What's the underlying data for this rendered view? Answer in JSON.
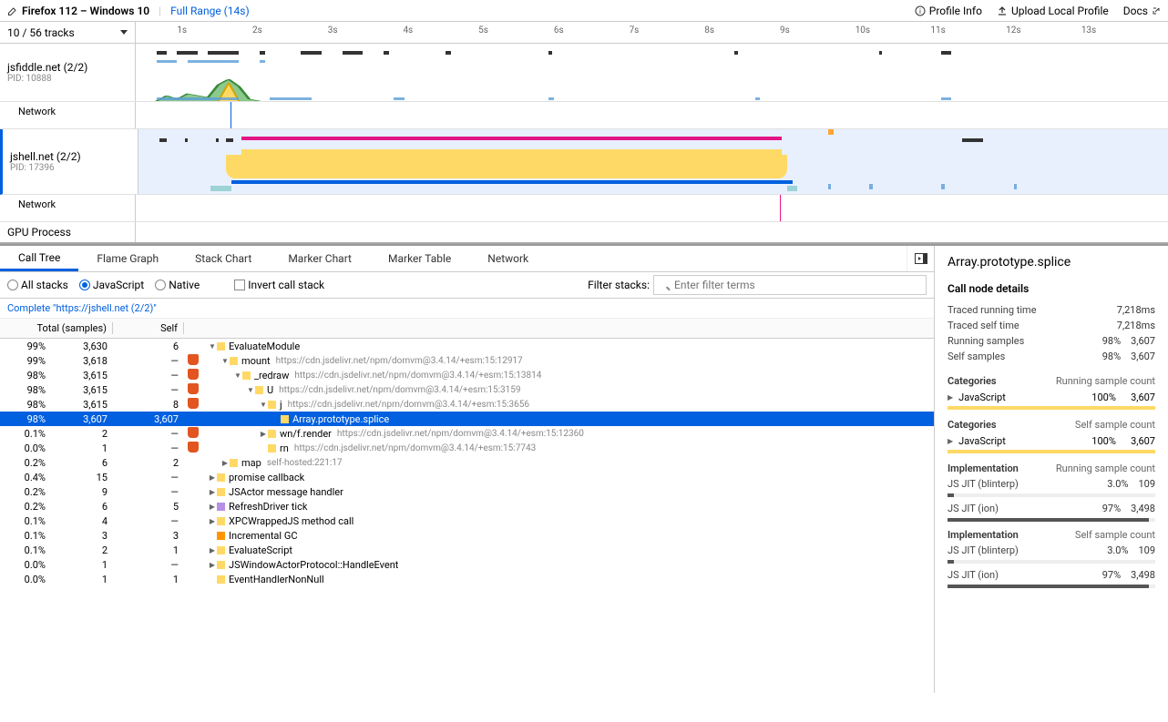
{
  "topbar": {
    "profile_name": "Firefox 112 – Windows 10",
    "range_label": "Full Range (14s)",
    "profile_info": "Profile Info",
    "upload": "Upload Local Profile",
    "docs": "Docs"
  },
  "timeline": {
    "track_count": "10 / 56 tracks",
    "ticks": [
      "1s",
      "2s",
      "3s",
      "4s",
      "5s",
      "6s",
      "7s",
      "8s",
      "9s",
      "10s",
      "11s",
      "12s",
      "13s"
    ],
    "tracks": [
      {
        "title": "jsfiddle.net (2/2)",
        "pid": "PID: 10888",
        "network": "Network"
      },
      {
        "title": "jshell.net (2/2)",
        "pid": "PID: 17396",
        "network": "Network"
      },
      {
        "title": "GPU Process"
      }
    ]
  },
  "tabs": [
    "Call Tree",
    "Flame Graph",
    "Stack Chart",
    "Marker Chart",
    "Marker Table",
    "Network"
  ],
  "toolbar": {
    "stack_radios": [
      "All stacks",
      "JavaScript",
      "Native"
    ],
    "invert": "Invert call stack",
    "filter_label": "Filter stacks:",
    "filter_placeholder": "Enter filter terms"
  },
  "breadcrumb": "Complete \"https://jshell.net (2/2)\"",
  "tree_headers": {
    "total": "Total (samples)",
    "self": "Self"
  },
  "tree": [
    {
      "tp": "99%",
      "tv": "3,630",
      "sv": "6",
      "badge": "",
      "indent": 0,
      "twisty": "▼",
      "cat": "js",
      "name": "EvaluateModule",
      "path": ""
    },
    {
      "tp": "99%",
      "tv": "3,618",
      "sv": "—",
      "badge": "s",
      "indent": 1,
      "twisty": "▼",
      "cat": "js",
      "name": "mount",
      "path": "https://cdn.jsdelivr.net/npm/domvm@3.4.14/+esm:15:12917"
    },
    {
      "tp": "98%",
      "tv": "3,615",
      "sv": "—",
      "badge": "s",
      "indent": 2,
      "twisty": "▼",
      "cat": "js",
      "name": "_redraw",
      "path": "https://cdn.jsdelivr.net/npm/domvm@3.4.14/+esm:15:13814"
    },
    {
      "tp": "98%",
      "tv": "3,615",
      "sv": "—",
      "badge": "s",
      "indent": 3,
      "twisty": "▼",
      "cat": "js",
      "name": "U",
      "path": "https://cdn.jsdelivr.net/npm/domvm@3.4.14/+esm:15:3159"
    },
    {
      "tp": "98%",
      "tv": "3,615",
      "sv": "8",
      "badge": "s",
      "indent": 4,
      "twisty": "▼",
      "cat": "js",
      "name": "j",
      "path": "https://cdn.jsdelivr.net/npm/domvm@3.4.14/+esm:15:3656"
    },
    {
      "tp": "98%",
      "tv": "3,607",
      "sv": "3,607",
      "badge": "",
      "indent": 5,
      "twisty": "",
      "cat": "js",
      "name": "Array.prototype.splice",
      "path": "",
      "selected": true
    },
    {
      "tp": "0.1%",
      "tv": "2",
      "sv": "—",
      "badge": "s",
      "indent": 4,
      "twisty": "▶",
      "cat": "js",
      "name": "wn/f.render",
      "path": "https://cdn.jsdelivr.net/npm/domvm@3.4.14/+esm:15:12360"
    },
    {
      "tp": "0.0%",
      "tv": "1",
      "sv": "—",
      "badge": "s",
      "indent": 4,
      "twisty": "",
      "cat": "js",
      "name": "rn",
      "path": "https://cdn.jsdelivr.net/npm/domvm@3.4.14/+esm:15:7743"
    },
    {
      "tp": "0.2%",
      "tv": "6",
      "sv": "2",
      "badge": "",
      "indent": 1,
      "twisty": "▶",
      "cat": "js",
      "name": "map",
      "path": "self-hosted:221:17"
    },
    {
      "tp": "0.4%",
      "tv": "15",
      "sv": "—",
      "badge": "",
      "indent": 0,
      "twisty": "▶",
      "cat": "js",
      "name": "promise callback",
      "path": ""
    },
    {
      "tp": "0.2%",
      "tv": "9",
      "sv": "—",
      "badge": "",
      "indent": 0,
      "twisty": "▶",
      "cat": "js",
      "name": "JSActor message handler",
      "path": ""
    },
    {
      "tp": "0.2%",
      "tv": "6",
      "sv": "5",
      "badge": "",
      "indent": 0,
      "twisty": "▶",
      "cat": "purple",
      "name": "RefreshDriver tick",
      "path": ""
    },
    {
      "tp": "0.1%",
      "tv": "4",
      "sv": "—",
      "badge": "",
      "indent": 0,
      "twisty": "▶",
      "cat": "js",
      "name": "XPCWrappedJS method call",
      "path": ""
    },
    {
      "tp": "0.1%",
      "tv": "3",
      "sv": "3",
      "badge": "",
      "indent": 0,
      "twisty": "",
      "cat": "orange",
      "name": "Incremental GC",
      "path": ""
    },
    {
      "tp": "0.1%",
      "tv": "2",
      "sv": "1",
      "badge": "",
      "indent": 0,
      "twisty": "▶",
      "cat": "js",
      "name": "EvaluateScript",
      "path": ""
    },
    {
      "tp": "0.0%",
      "tv": "1",
      "sv": "—",
      "badge": "",
      "indent": 0,
      "twisty": "▶",
      "cat": "js",
      "name": "JSWindowActorProtocol::HandleEvent",
      "path": ""
    },
    {
      "tp": "0.0%",
      "tv": "1",
      "sv": "1",
      "badge": "",
      "indent": 0,
      "twisty": "",
      "cat": "js",
      "name": "EventHandlerNonNull",
      "path": ""
    }
  ],
  "sidebar": {
    "title": "Array.prototype.splice",
    "section_details": "Call node details",
    "running_time_lbl": "Traced running time",
    "running_time_val": "7,218ms",
    "self_time_lbl": "Traced self time",
    "self_time_val": "7,218ms",
    "running_samples_lbl": "Running samples",
    "running_samples_pct": "98%",
    "running_samples_val": "3,607",
    "self_samples_lbl": "Self samples",
    "self_samples_pct": "98%",
    "self_samples_val": "3,607",
    "cat_running_hdr_l": "Categories",
    "cat_running_hdr_r": "Running sample count",
    "cat_js": "JavaScript",
    "cat_js_pct": "100%",
    "cat_js_val": "3,607",
    "cat_self_hdr_l": "Categories",
    "cat_self_hdr_r": "Self sample count",
    "impl_running_hdr_l": "Implementation",
    "impl_running_hdr_r": "Running sample count",
    "impl_blinterp": "JS JIT (blinterp)",
    "impl_blinterp_pct": "3.0%",
    "impl_blinterp_val": "109",
    "impl_ion": "JS JIT (ion)",
    "impl_ion_pct": "97%",
    "impl_ion_val": "3,498",
    "impl_self_hdr_l": "Implementation",
    "impl_self_hdr_r": "Self sample count"
  }
}
